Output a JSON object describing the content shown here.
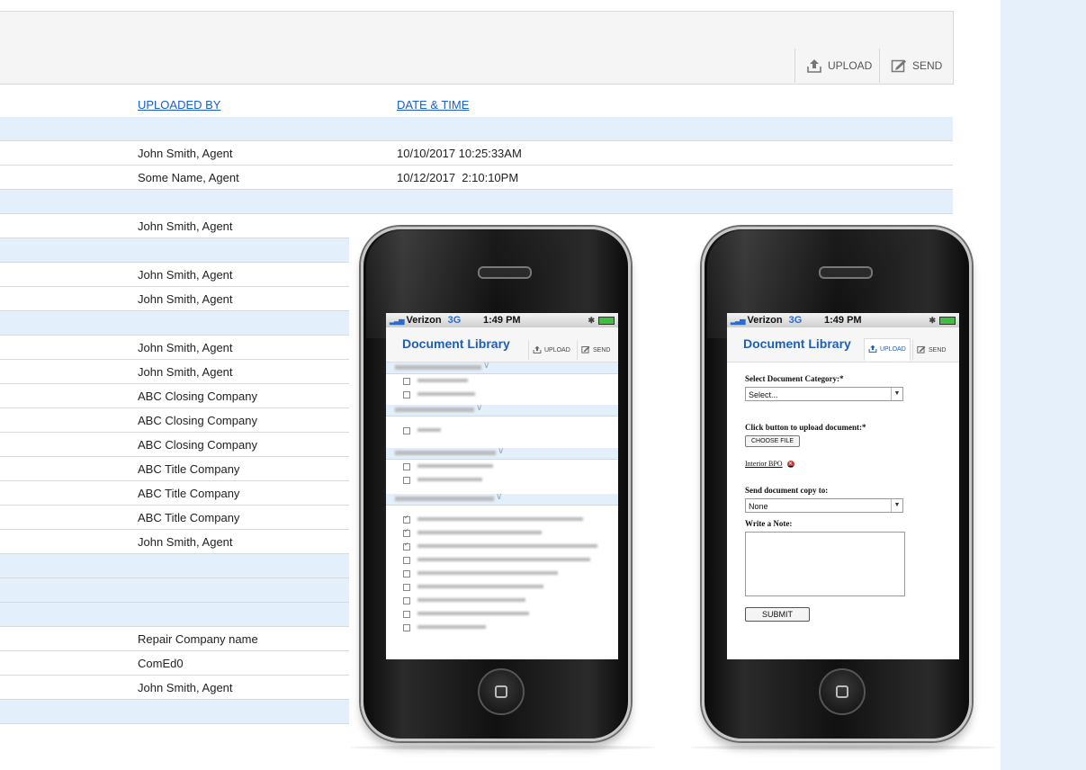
{
  "toolbar": {
    "upload_label": "UPLOAD",
    "send_label": "SEND"
  },
  "columns": {
    "uploaded_by": "UPLOADED BY",
    "date_time": "DATE & TIME"
  },
  "rows": [
    {
      "kind": "group"
    },
    {
      "kind": "item",
      "by": "John Smith, Agent",
      "date": "10/10/2017 10:25:33AM"
    },
    {
      "kind": "item",
      "by": "Some Name, Agent",
      "date": "10/12/2017  2:10:10PM"
    },
    {
      "kind": "group"
    },
    {
      "kind": "item",
      "by": "John Smith, Agent",
      "date": ""
    },
    {
      "kind": "group"
    },
    {
      "kind": "item",
      "by": "John Smith, Agent",
      "date": ""
    },
    {
      "kind": "item",
      "by": "John Smith, Agent",
      "date": ""
    },
    {
      "kind": "group"
    },
    {
      "kind": "item",
      "by": "John Smith, Agent",
      "date": ""
    },
    {
      "kind": "item",
      "by": "John Smith, Agent",
      "date": ""
    },
    {
      "kind": "item",
      "by": "ABC Closing Company",
      "date": ""
    },
    {
      "kind": "item",
      "by": "ABC Closing Company",
      "date": ""
    },
    {
      "kind": "item",
      "by": "ABC Closing Company",
      "date": ""
    },
    {
      "kind": "item",
      "by": "ABC Title Company",
      "date": ""
    },
    {
      "kind": "item",
      "by": "ABC Title Company",
      "date": ""
    },
    {
      "kind": "item",
      "by": "ABC Title Company",
      "date": ""
    },
    {
      "kind": "item",
      "by": "John Smith, Agent",
      "date": ""
    },
    {
      "kind": "group"
    },
    {
      "kind": "group"
    },
    {
      "kind": "group"
    },
    {
      "kind": "item",
      "by": "Repair Company name",
      "date": ""
    },
    {
      "kind": "item",
      "by": "ComEd0",
      "date": ""
    },
    {
      "kind": "item",
      "by": "John Smith, Agent",
      "date": ""
    },
    {
      "kind": "group"
    }
  ],
  "phone_status": {
    "carrier": "Verizon",
    "network": "3G",
    "time": "1:49 PM"
  },
  "phone_left": {
    "title": "Document Library",
    "upload_label": "UPLOAD",
    "send_label": "SEND"
  },
  "phone_right": {
    "title": "Document Library",
    "upload_label": "UPLOAD",
    "send_label": "SEND",
    "category_label": "Select Document Category:*",
    "category_value": "Select...",
    "upload_prompt": "Click button to upload document:*",
    "choose_file_label": "CHOOSE FILE",
    "attached_file": "Interior BPO",
    "send_copy_label": "Send document copy to:",
    "send_copy_value": "None",
    "note_label": "Write a Note:",
    "submit_label": "SUBMIT"
  }
}
